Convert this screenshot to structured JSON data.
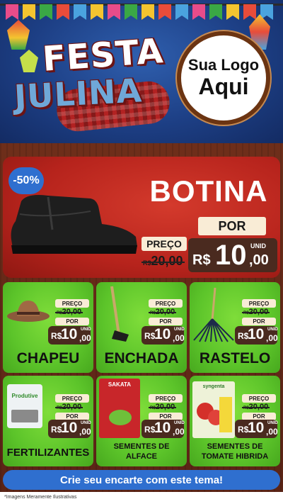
{
  "header": {
    "festa_title": "FESTA",
    "julina_title": "JULINA",
    "logo_line1": "Sua Logo",
    "logo_line2": "Aqui"
  },
  "hero": {
    "discount": "-50%",
    "title": "BOTINA",
    "preco_label": "PREÇO",
    "old_currency": "R$",
    "old_price": "20,00",
    "por_label": "POR",
    "unid_label": "UNID",
    "currency": "R$",
    "price_int": "10",
    "price_cents": ",00"
  },
  "products": [
    {
      "name": "CHAPEU",
      "preco_label": "PREÇO",
      "old_currency": "R$",
      "old_price": "20,00",
      "por_label": "POR",
      "currency": "R$",
      "price_int": "10",
      "price_cents": ",00",
      "unid_label": "UNID"
    },
    {
      "name": "ENCHADA",
      "preco_label": "PREÇO",
      "old_currency": "R$",
      "old_price": "20,00",
      "por_label": "POR",
      "currency": "R$",
      "price_int": "10",
      "price_cents": ",00",
      "unid_label": "UNID"
    },
    {
      "name": "RASTELO",
      "preco_label": "PREÇO",
      "old_currency": "R$",
      "old_price": "20,00",
      "por_label": "POR",
      "currency": "R$",
      "price_int": "10",
      "price_cents": ",00",
      "unid_label": "UNID"
    },
    {
      "name": "FERTILIZANTES",
      "preco_label": "PREÇO",
      "old_currency": "R$",
      "old_price": "20,00",
      "por_label": "POR",
      "currency": "R$",
      "price_int": "10",
      "price_cents": ",00",
      "unid_label": "UNID",
      "pack_brand": "Produtive"
    },
    {
      "name_line1": "SEMENTES DE",
      "name_line2": "ALFACE",
      "preco_label": "PREÇO",
      "old_currency": "R$",
      "old_price": "20,00",
      "por_label": "POR",
      "currency": "R$",
      "price_int": "10",
      "price_cents": ",00",
      "unid_label": "UNID",
      "pack_brand": "SAKATA"
    },
    {
      "name_line1": "SEMENTES DE",
      "name_line2": "TOMATE HIBRIDA",
      "preco_label": "PREÇO",
      "old_currency": "R$",
      "old_price": "20,00",
      "por_label": "POR",
      "currency": "R$",
      "price_int": "10",
      "price_cents": ",00",
      "unid_label": "UNID",
      "pack_brand": "syngenta"
    }
  ],
  "cta_label": "Crie seu encarte com este tema!",
  "footnote": "*Imagens Meramente Ilustrativas",
  "colors": {
    "header_blue": "#1d3f85",
    "hero_red": "#b6231c",
    "card_green": "#5cc42a",
    "price_dark": "#4a2a1f",
    "cta_blue": "#2f6fcf",
    "wood": "#5a2416"
  }
}
